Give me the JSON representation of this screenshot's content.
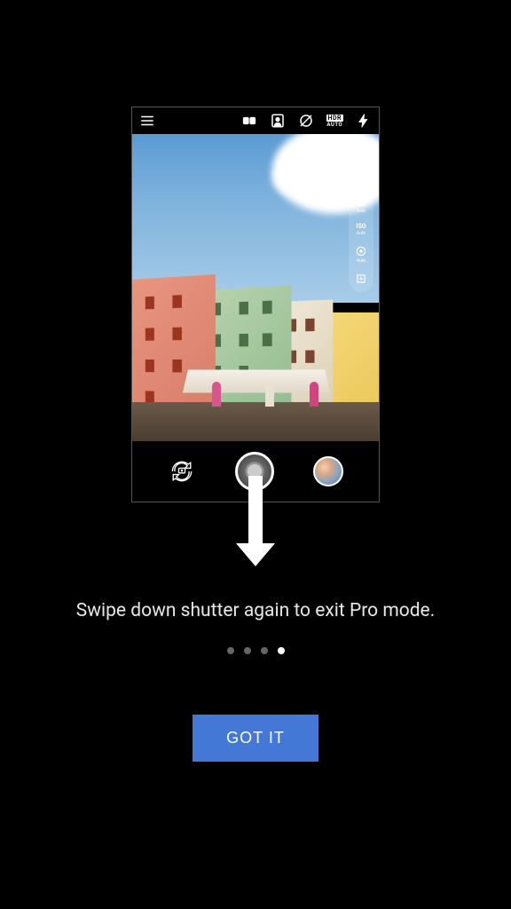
{
  "tutorial": {
    "hint_text": "Swipe down shutter again to exit Pro mode.",
    "button_label": "GOT IT",
    "current_page": 4,
    "total_pages": 4
  },
  "camera_mock": {
    "top_icons": {
      "menu": "hamburger",
      "mode": "dual-camera",
      "portrait": "portrait",
      "filter": "no-filter",
      "hdr_top": "HDR",
      "hdr_bottom": "AUTO",
      "flash": "flash"
    },
    "pro_controls": [
      {
        "icon": "wb",
        "label": "Auto"
      },
      {
        "icon": "shutter-speed",
        "label": "Auto"
      },
      {
        "icon": "iso",
        "label": "ISO"
      },
      {
        "icon": "iso-sub",
        "label": "Auto"
      },
      {
        "icon": "focus",
        "label": "Auto"
      },
      {
        "icon": "ev",
        "label": ""
      }
    ]
  },
  "colors": {
    "primary_button": "#4378d6",
    "background": "#000000",
    "text": "#ffffff"
  }
}
